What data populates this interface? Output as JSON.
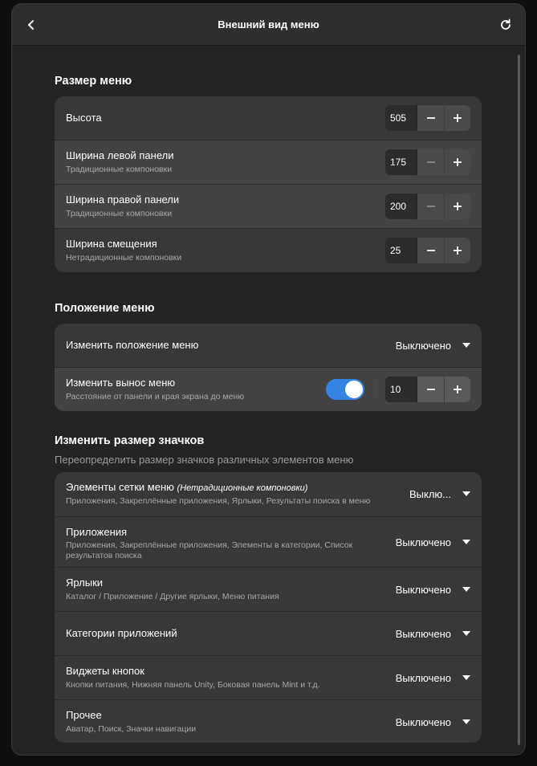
{
  "header": {
    "title": "Внешний вид меню"
  },
  "icons": {
    "back": "chevron-left-icon",
    "refresh": "refresh-icon",
    "minus": "minus-icon",
    "plus": "plus-icon",
    "dropdown": "chevron-down-icon"
  },
  "colors": {
    "accent": "#3584e4",
    "window_bg": "#242424",
    "card_bg": "#383838"
  },
  "menu_size": {
    "title": "Размер меню",
    "rows": [
      {
        "title": "Высота",
        "value": "505"
      },
      {
        "title": "Ширина левой панели",
        "subtitle": "Традиционные компоновки",
        "value": "175"
      },
      {
        "title": "Ширина правой панели",
        "subtitle": "Традиционные компоновки",
        "value": "200"
      },
      {
        "title": "Ширина смещения",
        "subtitle": "Нетрадиционные компоновки",
        "value": "25"
      }
    ]
  },
  "menu_position": {
    "title": "Положение меню",
    "rows": [
      {
        "title": "Изменить положение меню",
        "value": "Выключено"
      },
      {
        "title": "Изменить вынос меню",
        "subtitle": "Расстояние от панели и края экрана до меню",
        "switch_on": true,
        "value": "10"
      }
    ]
  },
  "icon_size": {
    "title": "Изменить размер значков",
    "description": "Переопределить размер значков различных элементов меню",
    "rows": [
      {
        "title": "Элементы сетки меню",
        "title_note": "(Нетрадиционные компоновки)",
        "subtitle": "Приложения, Закреплённые приложения, Ярлыки, Результаты поиска в меню",
        "value": "Выклю..."
      },
      {
        "title": "Приложения",
        "subtitle": "Приложения, Закреплённые приложения, Элементы в категории, Список результатов поиска",
        "value": "Выключено"
      },
      {
        "title": "Ярлыки",
        "subtitle": "Каталог / Приложение / Другие ярлыки, Меню питания",
        "value": "Выключено"
      },
      {
        "title": "Категории приложений",
        "value": "Выключено"
      },
      {
        "title": "Виджеты кнопок",
        "subtitle": "Кнопки питания, Нижняя панель Unity, Боковая панель Mint и т.д.",
        "value": "Выключено"
      },
      {
        "title": "Прочее",
        "subtitle": "Аватар, Поиск, Значки навигации",
        "value": "Выключено"
      }
    ]
  }
}
